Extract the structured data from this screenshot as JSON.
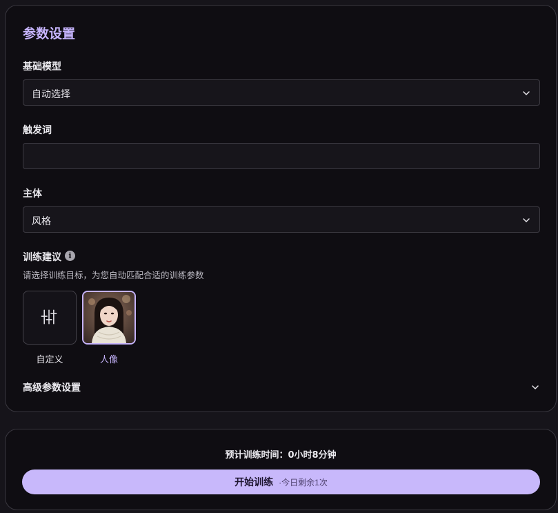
{
  "panel": {
    "title": "参数设置",
    "base_model": {
      "label": "基础模型",
      "value": "自动选择"
    },
    "trigger_word": {
      "label": "触发词",
      "value": "",
      "placeholder": ""
    },
    "subject": {
      "label": "主体",
      "value": "风格"
    },
    "training_suggestion": {
      "label": "训练建议",
      "info_icon": "info-icon",
      "hint": "请选择训练目标，为您自动匹配合适的训练参数",
      "presets": [
        {
          "label": "自定义",
          "icon": "sliders-icon",
          "selected": false
        },
        {
          "label": "人像",
          "icon": "portrait-image",
          "selected": true
        }
      ]
    },
    "advanced": {
      "label": "高级参数设置",
      "icon": "chevron-down-icon"
    }
  },
  "footer": {
    "estimate": "预计训练时间：0小时8分钟",
    "start_button": {
      "label": "开始训练",
      "sub": "·今日剩余1次"
    }
  },
  "colors": {
    "accent": "#c5b3fb",
    "button_bg": "#c8b8fb",
    "panel_bg": "#0f0d12",
    "page_bg": "#16141a"
  }
}
